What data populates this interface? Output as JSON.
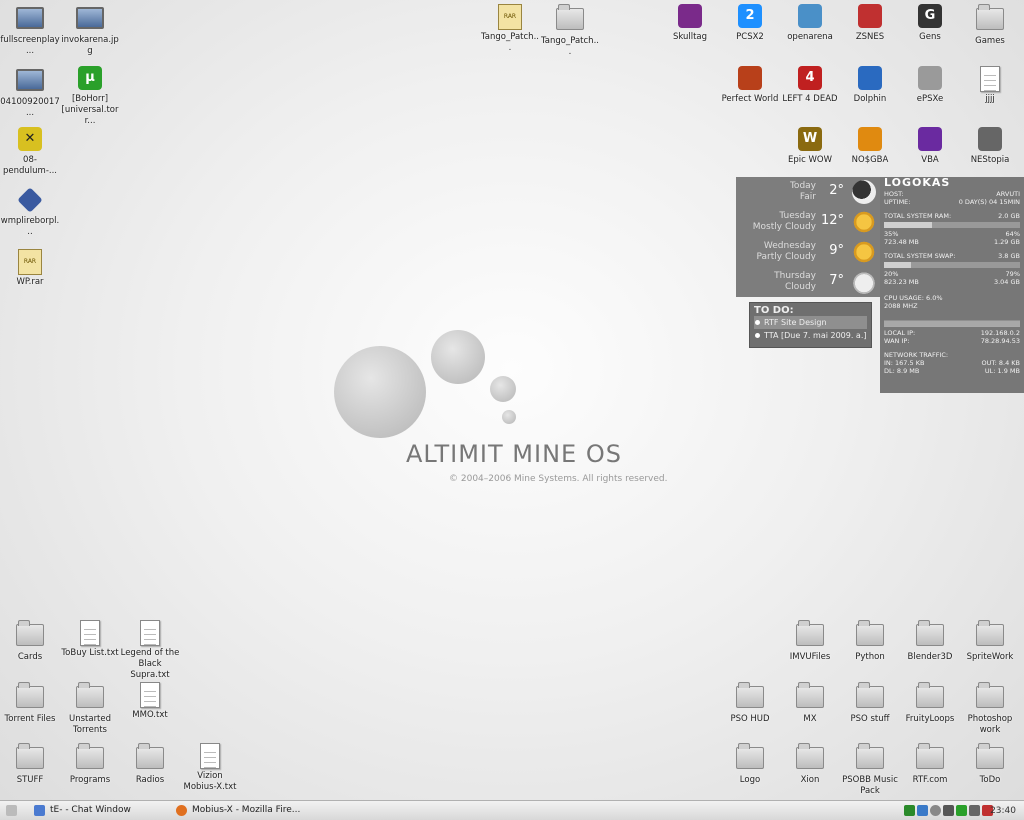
{
  "desktop_icons": {
    "top_left": [
      {
        "label": "fullscreenplay...",
        "type": "monitor"
      },
      {
        "label": "invokarena.jpg",
        "type": "monitor"
      },
      {
        "label": "04100920017...",
        "type": "monitor"
      },
      {
        "label": "[BoHorr] [universal.torr...",
        "type": "utorrent"
      },
      {
        "label": "08-pendulum-...",
        "type": "media"
      },
      {
        "label": "wmplireborpl...",
        "type": "media2"
      },
      {
        "label": "WP.rar",
        "type": "archive"
      }
    ],
    "top_center": [
      {
        "label": "Tango_Patch...",
        "type": "archive"
      },
      {
        "label": "Tango_Patch...",
        "type": "folder"
      }
    ],
    "top_right_row1": [
      {
        "label": "Skulltag",
        "type": "app",
        "color": "#7a2a8a"
      },
      {
        "label": "PCSX2",
        "type": "app",
        "color": "#1e90ff",
        "glyph": "2"
      },
      {
        "label": "openarena",
        "type": "app",
        "color": "#4a90c8"
      },
      {
        "label": "ZSNES",
        "type": "app",
        "color": "#c03030"
      },
      {
        "label": "Gens",
        "type": "app",
        "color": "#333333",
        "glyph": "G"
      },
      {
        "label": "Games",
        "type": "folder"
      }
    ],
    "top_right_row2": [
      {
        "label": "Perfect World",
        "type": "app",
        "color": "#b8401a"
      },
      {
        "label": "LEFT 4 DEAD",
        "type": "app",
        "color": "#c02020",
        "glyph": "4"
      },
      {
        "label": "Dolphin",
        "type": "app",
        "color": "#2a6ac0"
      },
      {
        "label": "ePSXe",
        "type": "app",
        "color": "#9a9a9a"
      },
      {
        "label": "jjjj",
        "type": "doc"
      }
    ],
    "top_right_row3": [
      {
        "label": "Epic WOW",
        "type": "app",
        "color": "#8a6a10",
        "glyph": "W"
      },
      {
        "label": "NO$GBA",
        "type": "app",
        "color": "#e08a10"
      },
      {
        "label": "VBA",
        "type": "app",
        "color": "#6a2aa0"
      },
      {
        "label": "NEStopia",
        "type": "app",
        "color": "#666666"
      }
    ],
    "bottom_left": [
      {
        "label": "Cards",
        "type": "folder"
      },
      {
        "label": "ToBuy List.txt",
        "type": "doc"
      },
      {
        "label": "Legend of the Black Supra.txt",
        "type": "doc"
      },
      {
        "label": "Torrent Files",
        "type": "folder"
      },
      {
        "label": "Unstarted Torrents",
        "type": "folder"
      },
      {
        "label": "MMO.txt",
        "type": "doc"
      },
      {
        "label": "STUFF",
        "type": "folder"
      },
      {
        "label": "Programs",
        "type": "folder"
      },
      {
        "label": "Radios",
        "type": "folder"
      },
      {
        "label": "Vizion Mobius-X.txt",
        "type": "doc"
      }
    ],
    "bottom_right": [
      {
        "label": "IMVUFiles",
        "type": "folder"
      },
      {
        "label": "Python",
        "type": "folder"
      },
      {
        "label": "Blender3D",
        "type": "folder"
      },
      {
        "label": "SpriteWork",
        "type": "folder"
      },
      {
        "label": "PSO HUD",
        "type": "folder"
      },
      {
        "label": "MX",
        "type": "folder"
      },
      {
        "label": "PSO stuff",
        "type": "folder"
      },
      {
        "label": "FruityLoops",
        "type": "folder"
      },
      {
        "label": "Photoshop work",
        "type": "folder"
      },
      {
        "label": "Logo",
        "type": "folder"
      },
      {
        "label": "Xion",
        "type": "folder"
      },
      {
        "label": "PSOBB Music Pack",
        "type": "folder"
      },
      {
        "label": "RTF.com",
        "type": "folder"
      },
      {
        "label": "ToDo",
        "type": "folder"
      }
    ]
  },
  "weather": [
    {
      "day": "Today",
      "cond": "Fair",
      "temp": "2°",
      "icon": "moon"
    },
    {
      "day": "Tuesday",
      "cond": "Mostly Cloudy",
      "temp": "12°",
      "icon": "sun"
    },
    {
      "day": "Wednesday",
      "cond": "Partly Cloudy",
      "temp": "9°",
      "icon": "sun"
    },
    {
      "day": "Thursday",
      "cond": "Cloudy",
      "temp": "7°",
      "icon": "cloud"
    }
  ],
  "sysmon": {
    "hostname": "LOGOKAS",
    "host_label": "HOST:",
    "host_value": "ARVUTI",
    "uptime_label": "UPTIME:",
    "uptime_value": "0 DAY(S) 04 15MIN",
    "ram_label": "TOTAL SYSTEM RAM:",
    "ram_total": "2.0 GB",
    "ram_pct_left": "35%",
    "ram_pct_right": "64%",
    "ram_used": "723.48 MB",
    "ram_free": "1.29 GB",
    "ram_fill": 0.35,
    "swap_label": "TOTAL SYSTEM SWAP:",
    "swap_total": "3.8 GB",
    "swap_pct_left": "20%",
    "swap_pct_right": "79%",
    "swap_used": "823.23 MB",
    "swap_free": "3.04 GB",
    "swap_fill": 0.2,
    "cpu_label": "CPU USAGE: 6.0%",
    "cpu_freq": "2088 MHZ",
    "local_ip_label": "LOCAL IP:",
    "local_ip": "192.168.0.2",
    "wan_ip_label": "WAN IP:",
    "wan_ip": "78.28.94.53",
    "net_label": "NETWORK TRAFFIC:",
    "net_in": "IN: 167.5 KB",
    "net_out": "OUT: 8.4 KB",
    "net_dl": "DL: 8.9 MB",
    "net_ul": "UL: 1.9 MB"
  },
  "todo": {
    "title": "TO DO:",
    "items": [
      "RTF Site Design",
      "TTA [Due 7. mai 2009. a.]"
    ]
  },
  "wallpaper": {
    "brand": "ALTIMIT MINE OS",
    "copyright": "© 2004–2006 Mine Systems. All rights reserved."
  },
  "taskbar": {
    "tasks": [
      {
        "label": "tE- - Chat Window",
        "color": "#4a7ad0"
      },
      {
        "label": "Mobius-X - Mozilla Fire...",
        "color": "#e07020"
      }
    ],
    "clock": "23:40"
  }
}
